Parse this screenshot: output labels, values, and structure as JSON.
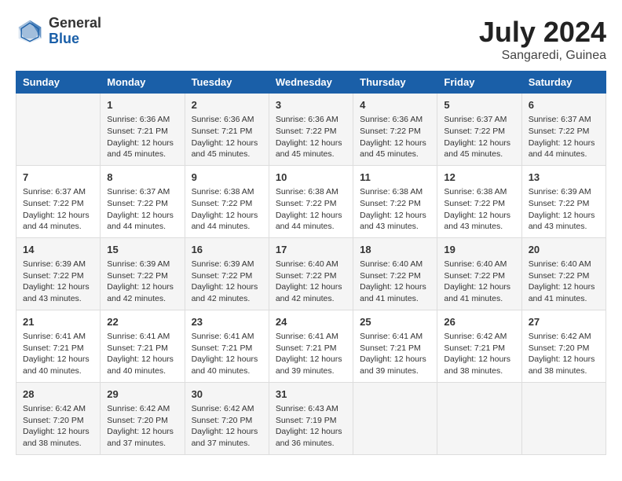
{
  "header": {
    "logo_general": "General",
    "logo_blue": "Blue",
    "month_year": "July 2024",
    "location": "Sangaredi, Guinea"
  },
  "days_of_week": [
    "Sunday",
    "Monday",
    "Tuesday",
    "Wednesday",
    "Thursday",
    "Friday",
    "Saturday"
  ],
  "weeks": [
    [
      {
        "day": "",
        "content": ""
      },
      {
        "day": "1",
        "content": "Sunrise: 6:36 AM\nSunset: 7:21 PM\nDaylight: 12 hours\nand 45 minutes."
      },
      {
        "day": "2",
        "content": "Sunrise: 6:36 AM\nSunset: 7:21 PM\nDaylight: 12 hours\nand 45 minutes."
      },
      {
        "day": "3",
        "content": "Sunrise: 6:36 AM\nSunset: 7:22 PM\nDaylight: 12 hours\nand 45 minutes."
      },
      {
        "day": "4",
        "content": "Sunrise: 6:36 AM\nSunset: 7:22 PM\nDaylight: 12 hours\nand 45 minutes."
      },
      {
        "day": "5",
        "content": "Sunrise: 6:37 AM\nSunset: 7:22 PM\nDaylight: 12 hours\nand 45 minutes."
      },
      {
        "day": "6",
        "content": "Sunrise: 6:37 AM\nSunset: 7:22 PM\nDaylight: 12 hours\nand 44 minutes."
      }
    ],
    [
      {
        "day": "7",
        "content": "Sunrise: 6:37 AM\nSunset: 7:22 PM\nDaylight: 12 hours\nand 44 minutes."
      },
      {
        "day": "8",
        "content": "Sunrise: 6:37 AM\nSunset: 7:22 PM\nDaylight: 12 hours\nand 44 minutes."
      },
      {
        "day": "9",
        "content": "Sunrise: 6:38 AM\nSunset: 7:22 PM\nDaylight: 12 hours\nand 44 minutes."
      },
      {
        "day": "10",
        "content": "Sunrise: 6:38 AM\nSunset: 7:22 PM\nDaylight: 12 hours\nand 44 minutes."
      },
      {
        "day": "11",
        "content": "Sunrise: 6:38 AM\nSunset: 7:22 PM\nDaylight: 12 hours\nand 43 minutes."
      },
      {
        "day": "12",
        "content": "Sunrise: 6:38 AM\nSunset: 7:22 PM\nDaylight: 12 hours\nand 43 minutes."
      },
      {
        "day": "13",
        "content": "Sunrise: 6:39 AM\nSunset: 7:22 PM\nDaylight: 12 hours\nand 43 minutes."
      }
    ],
    [
      {
        "day": "14",
        "content": "Sunrise: 6:39 AM\nSunset: 7:22 PM\nDaylight: 12 hours\nand 43 minutes."
      },
      {
        "day": "15",
        "content": "Sunrise: 6:39 AM\nSunset: 7:22 PM\nDaylight: 12 hours\nand 42 minutes."
      },
      {
        "day": "16",
        "content": "Sunrise: 6:39 AM\nSunset: 7:22 PM\nDaylight: 12 hours\nand 42 minutes."
      },
      {
        "day": "17",
        "content": "Sunrise: 6:40 AM\nSunset: 7:22 PM\nDaylight: 12 hours\nand 42 minutes."
      },
      {
        "day": "18",
        "content": "Sunrise: 6:40 AM\nSunset: 7:22 PM\nDaylight: 12 hours\nand 41 minutes."
      },
      {
        "day": "19",
        "content": "Sunrise: 6:40 AM\nSunset: 7:22 PM\nDaylight: 12 hours\nand 41 minutes."
      },
      {
        "day": "20",
        "content": "Sunrise: 6:40 AM\nSunset: 7:22 PM\nDaylight: 12 hours\nand 41 minutes."
      }
    ],
    [
      {
        "day": "21",
        "content": "Sunrise: 6:41 AM\nSunset: 7:21 PM\nDaylight: 12 hours\nand 40 minutes."
      },
      {
        "day": "22",
        "content": "Sunrise: 6:41 AM\nSunset: 7:21 PM\nDaylight: 12 hours\nand 40 minutes."
      },
      {
        "day": "23",
        "content": "Sunrise: 6:41 AM\nSunset: 7:21 PM\nDaylight: 12 hours\nand 40 minutes."
      },
      {
        "day": "24",
        "content": "Sunrise: 6:41 AM\nSunset: 7:21 PM\nDaylight: 12 hours\nand 39 minutes."
      },
      {
        "day": "25",
        "content": "Sunrise: 6:41 AM\nSunset: 7:21 PM\nDaylight: 12 hours\nand 39 minutes."
      },
      {
        "day": "26",
        "content": "Sunrise: 6:42 AM\nSunset: 7:21 PM\nDaylight: 12 hours\nand 38 minutes."
      },
      {
        "day": "27",
        "content": "Sunrise: 6:42 AM\nSunset: 7:20 PM\nDaylight: 12 hours\nand 38 minutes."
      }
    ],
    [
      {
        "day": "28",
        "content": "Sunrise: 6:42 AM\nSunset: 7:20 PM\nDaylight: 12 hours\nand 38 minutes."
      },
      {
        "day": "29",
        "content": "Sunrise: 6:42 AM\nSunset: 7:20 PM\nDaylight: 12 hours\nand 37 minutes."
      },
      {
        "day": "30",
        "content": "Sunrise: 6:42 AM\nSunset: 7:20 PM\nDaylight: 12 hours\nand 37 minutes."
      },
      {
        "day": "31",
        "content": "Sunrise: 6:43 AM\nSunset: 7:19 PM\nDaylight: 12 hours\nand 36 minutes."
      },
      {
        "day": "",
        "content": ""
      },
      {
        "day": "",
        "content": ""
      },
      {
        "day": "",
        "content": ""
      }
    ]
  ]
}
